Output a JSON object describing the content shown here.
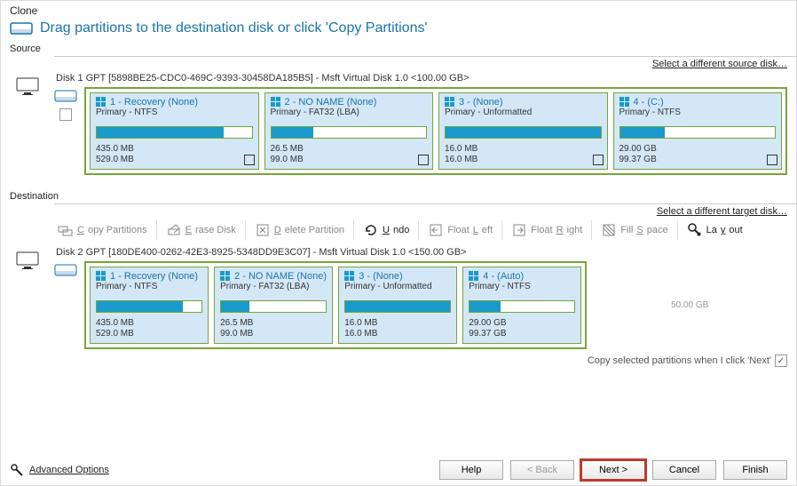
{
  "title": "Clone",
  "instruction": "Drag partitions to the destination disk or click 'Copy Partitions'",
  "source": {
    "label": "Source",
    "switch_link": "Select a different source disk…",
    "disk_line": "Disk 1 GPT [5898BE25-CDC0-469C-9393-30458DA185B5] - Msft     Virtual Disk     1.0   <100.00 GB>",
    "partitions": [
      {
        "title": "1 - Recovery (None)",
        "sub": "Primary - NTFS",
        "pct": 82,
        "used": "435.0 MB",
        "total": "529.0 MB",
        "locked": true
      },
      {
        "title": "2 - NO NAME (None)",
        "sub": "Primary - FAT32 (LBA)",
        "pct": 27,
        "used": "26.5 MB",
        "total": "99.0 MB",
        "locked": true
      },
      {
        "title": "3 -   (None)",
        "sub": "Primary - Unformatted",
        "pct": 100,
        "used": "16.0 MB",
        "total": "16.0 MB",
        "locked": true
      },
      {
        "title": "4 -   (C:)",
        "sub": "Primary - NTFS",
        "pct": 29,
        "used": "29.00 GB",
        "total": "99.37 GB",
        "locked": true
      }
    ]
  },
  "destination": {
    "label": "Destination",
    "switch_link": "Select a different target disk…",
    "disk_line": "Disk 2 GPT [180DE400-0262-42E3-8925-5348DD9E3C07] - Msft     Virtual Disk     1.0   <150.00 GB>",
    "partitions": [
      {
        "title": "1 - Recovery (None)",
        "sub": "Primary - NTFS",
        "pct": 82,
        "used": "435.0 MB",
        "total": "529.0 MB"
      },
      {
        "title": "2 - NO NAME (None)",
        "sub": "Primary - FAT32 (LBA)",
        "pct": 27,
        "used": "26.5 MB",
        "total": "99.0 MB"
      },
      {
        "title": "3 -   (None)",
        "sub": "Primary - Unformatted",
        "pct": 100,
        "used": "16.0 MB",
        "total": "16.0 MB"
      },
      {
        "title": "4 -   (Auto)",
        "sub": "Primary - NTFS",
        "pct": 29,
        "used": "29.00 GB",
        "total": "99.37 GB"
      }
    ],
    "free_label": "50.00 GB"
  },
  "toolbar": {
    "copy": "Copy Partitions",
    "erase": "Erase Disk",
    "delete": "Delete Partition",
    "undo": "Undo",
    "float_left": "Float Left",
    "float_right": "Float Right",
    "fill": "Fill Space",
    "layout": "Layout"
  },
  "footer": {
    "copy_check": "Copy selected partitions when I click 'Next'",
    "adv": "Advanced Options",
    "help": "Help",
    "back": "< Back",
    "next": "Next >",
    "cancel": "Cancel",
    "finish": "Finish"
  }
}
